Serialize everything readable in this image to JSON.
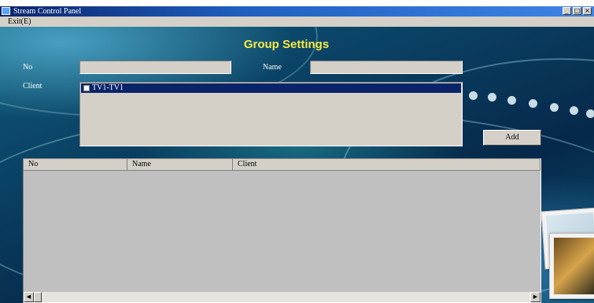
{
  "window": {
    "title": "Stream Control Panel",
    "controls": {
      "minimize": "_",
      "maximize": "□",
      "close": "×"
    }
  },
  "menu": {
    "exit_label": "Exit(E)"
  },
  "form": {
    "heading": "Group Settings",
    "no_label": "No",
    "no_value": "",
    "name_label": "Name",
    "name_value": "",
    "client_label": "Client",
    "clients": [
      {
        "label": "TV1-TV1",
        "checked": false,
        "selected": true
      }
    ],
    "add_button": "Add"
  },
  "table": {
    "columns": [
      "No",
      "Name",
      "Client"
    ],
    "rows": []
  },
  "scrollbar": {
    "left_arrow": "◀",
    "right_arrow": "▶"
  },
  "colors": {
    "title_bar": "#0a246a",
    "heading": "#f7ea43",
    "selection": "#0a246a",
    "panel": "#d4d0c8"
  }
}
